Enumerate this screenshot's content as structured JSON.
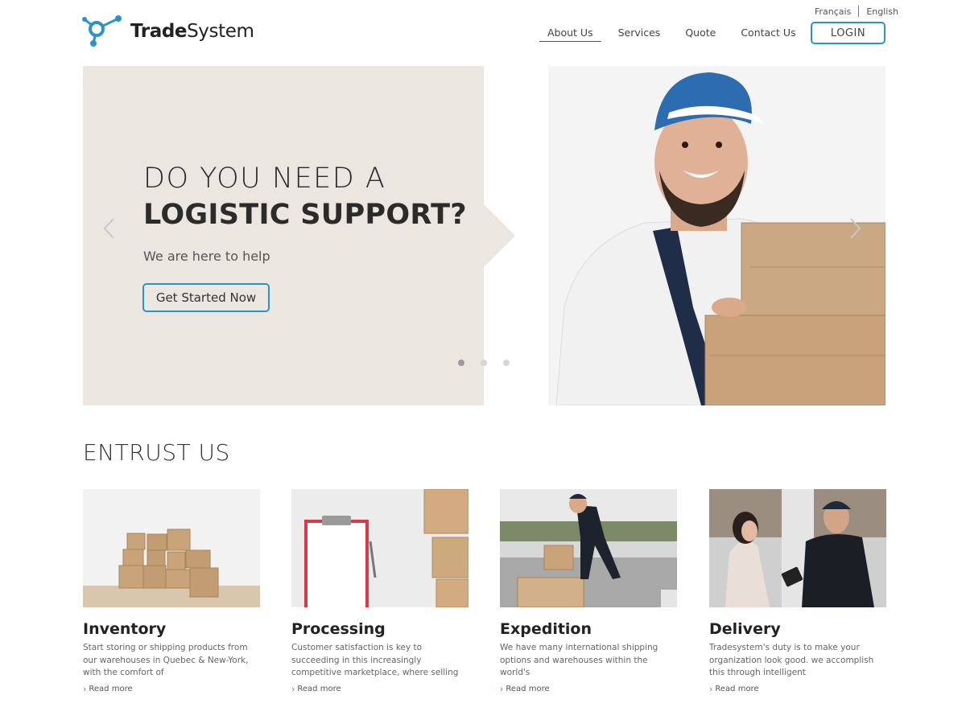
{
  "brand": {
    "name_bold": "Trade",
    "name_light": "System",
    "accent": "#2a93c9"
  },
  "lang": {
    "french": "Français",
    "english": "English"
  },
  "nav": {
    "items": [
      {
        "label": "About Us",
        "active": true
      },
      {
        "label": "Services"
      },
      {
        "label": "Quote"
      },
      {
        "label": "Contact Us"
      }
    ],
    "login": "LOGIN"
  },
  "hero": {
    "line1": "DO YOU NEED A",
    "line2": "LOGISTIC SUPPORT?",
    "subtitle": "We are here to help",
    "cta": "Get Started Now",
    "slides_total": 3,
    "active_slide": 1,
    "background": "#ece6e0"
  },
  "section": {
    "title": "ENTRUST US"
  },
  "cards": [
    {
      "title": "Inventory",
      "text": "Start storing or shipping products from our warehouses in Quebec & New-York, with the comfort of",
      "more": "Read more"
    },
    {
      "title": "Processing",
      "text": "Customer satisfaction is key to succeeding in this increasingly competitive marketplace, where selling",
      "more": "Read more"
    },
    {
      "title": "Expedition",
      "text": "We have many international shipping options and warehouses within the world's",
      "more": "Read more"
    },
    {
      "title": "Delivery",
      "text": "Tradesystem's duty is to make your organization look good. we accomplish this through intelligent",
      "more": "Read more"
    }
  ]
}
